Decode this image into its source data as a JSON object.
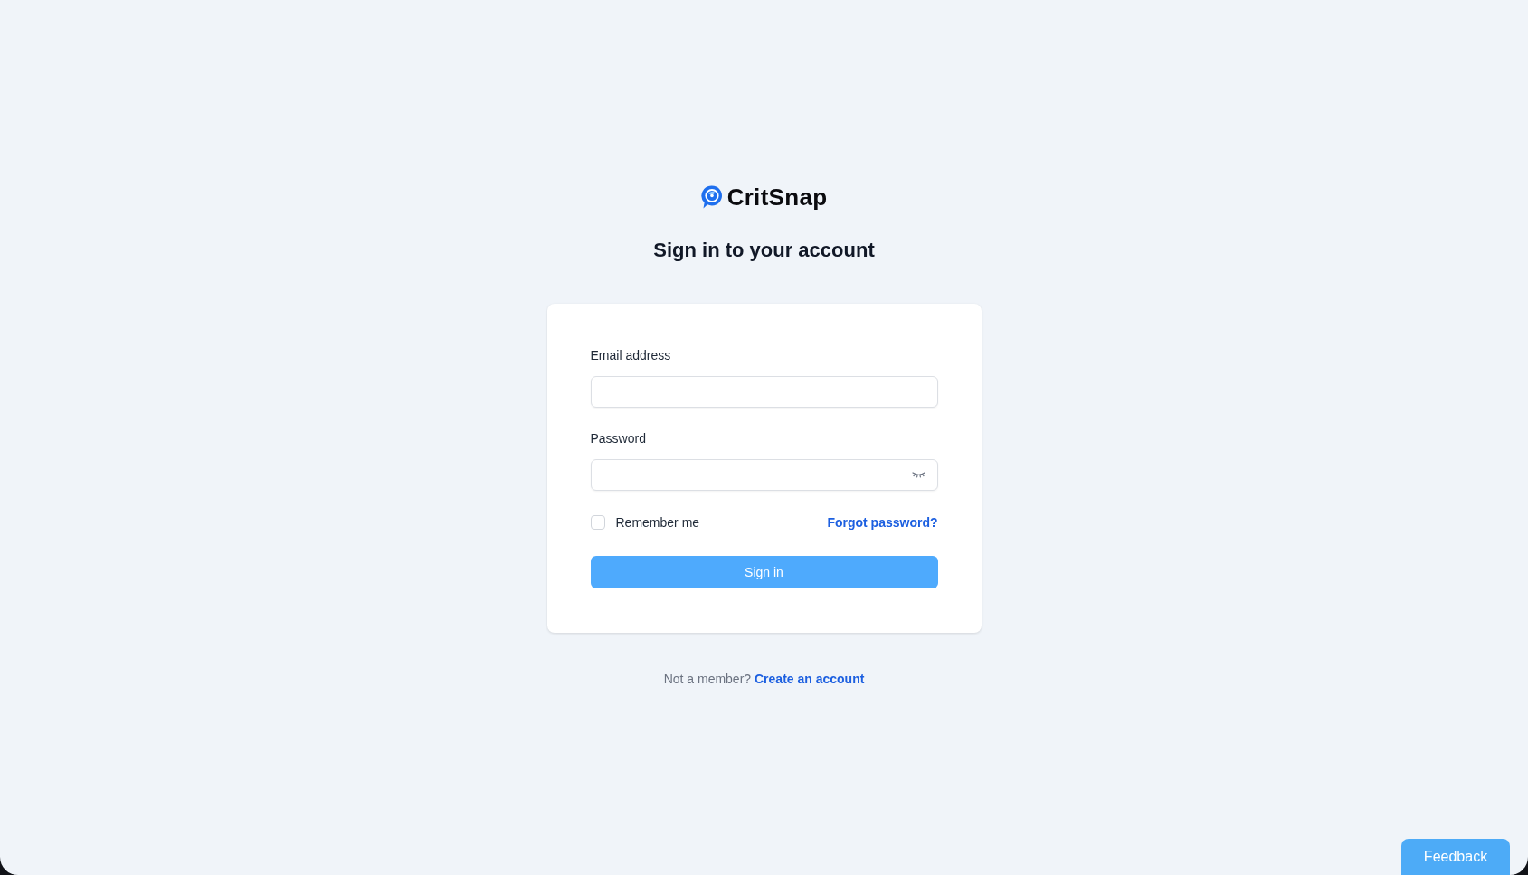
{
  "logo": {
    "name": "CritSnap"
  },
  "heading": "Sign in to your account",
  "form": {
    "fields": [
      {
        "kind": "email",
        "label": "Email address"
      },
      {
        "kind": "password",
        "label": "Password"
      }
    ],
    "remember_me": {
      "label": "Remember me",
      "checked": false
    },
    "forgot_link": "Forgot password?",
    "submit_button": "Sign in"
  },
  "footer": {
    "prompt": "Not a member?",
    "link": "Create an account"
  },
  "feedback_button": "Feedback"
}
